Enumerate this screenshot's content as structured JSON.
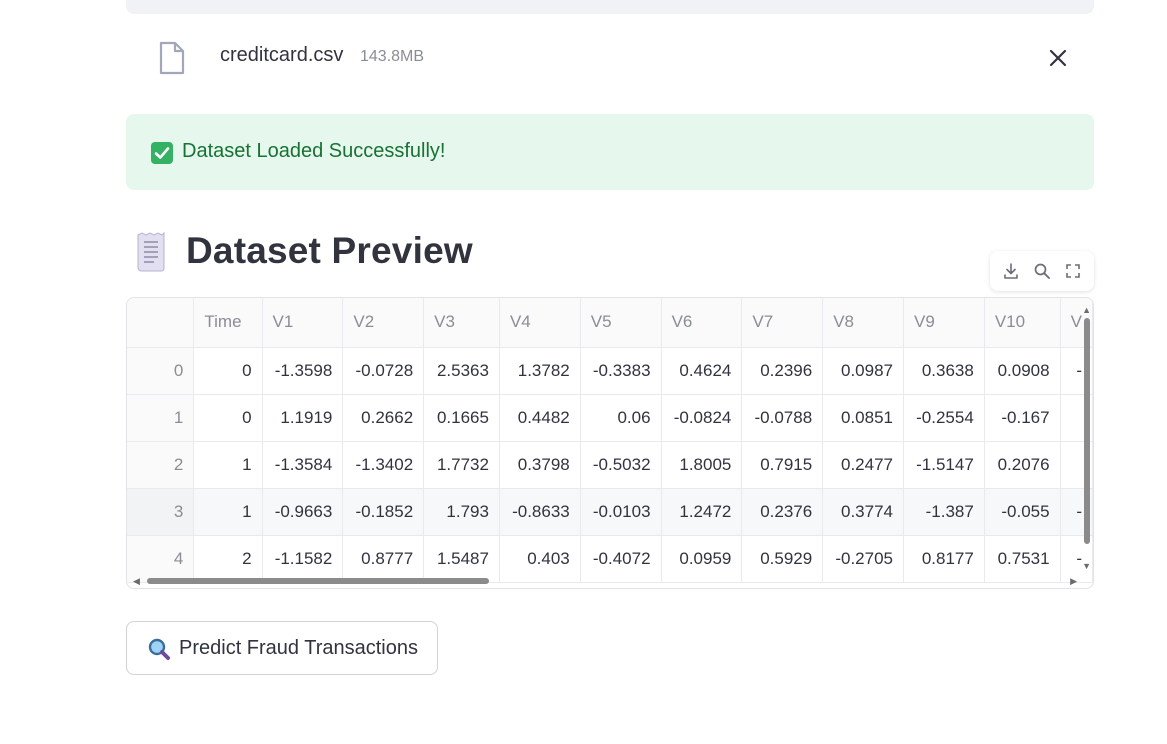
{
  "uploader": {
    "file_name": "creditcard.csv",
    "file_size": "143.8MB",
    "file_icon": "file-icon",
    "close_icon": "close-icon"
  },
  "alert": {
    "icon": "check-box-icon",
    "message": "Dataset Loaded Successfully!",
    "color_bg": "#e6f7ed",
    "color_text": "#177233"
  },
  "section": {
    "icon": "receipt-icon",
    "title": "Dataset Preview"
  },
  "toolbar": {
    "icons": [
      "download-icon",
      "search-icon",
      "fullscreen-icon"
    ]
  },
  "table": {
    "columns": [
      "",
      "Time",
      "V1",
      "V2",
      "V3",
      "V4",
      "V5",
      "V6",
      "V7",
      "V8",
      "V9",
      "V10",
      "V"
    ],
    "rows": [
      [
        "0",
        "0",
        "-1.3598",
        "-0.0728",
        "2.5363",
        "1.3782",
        "-0.3383",
        "0.4624",
        "0.2396",
        "0.0987",
        "0.3638",
        "0.0908",
        "-"
      ],
      [
        "1",
        "0",
        "1.1919",
        "0.2662",
        "0.1665",
        "0.4482",
        "0.06",
        "-0.0824",
        "-0.0788",
        "0.0851",
        "-0.2554",
        "-0.167",
        ""
      ],
      [
        "2",
        "1",
        "-1.3584",
        "-1.3402",
        "1.7732",
        "0.3798",
        "-0.5032",
        "1.8005",
        "0.7915",
        "0.2477",
        "-1.5147",
        "0.2076",
        ""
      ],
      [
        "3",
        "1",
        "-0.9663",
        "-0.1852",
        "1.793",
        "-0.8633",
        "-0.0103",
        "1.2472",
        "0.2376",
        "0.3774",
        "-1.387",
        "-0.055",
        "-"
      ],
      [
        "4",
        "2",
        "-1.1582",
        "0.8777",
        "1.5487",
        "0.403",
        "-0.4072",
        "0.0959",
        "0.5929",
        "-0.2705",
        "0.8177",
        "0.7531",
        "-"
      ]
    ]
  },
  "action": {
    "icon": "magnifier-icon",
    "label": "Predict Fraud Transactions"
  }
}
